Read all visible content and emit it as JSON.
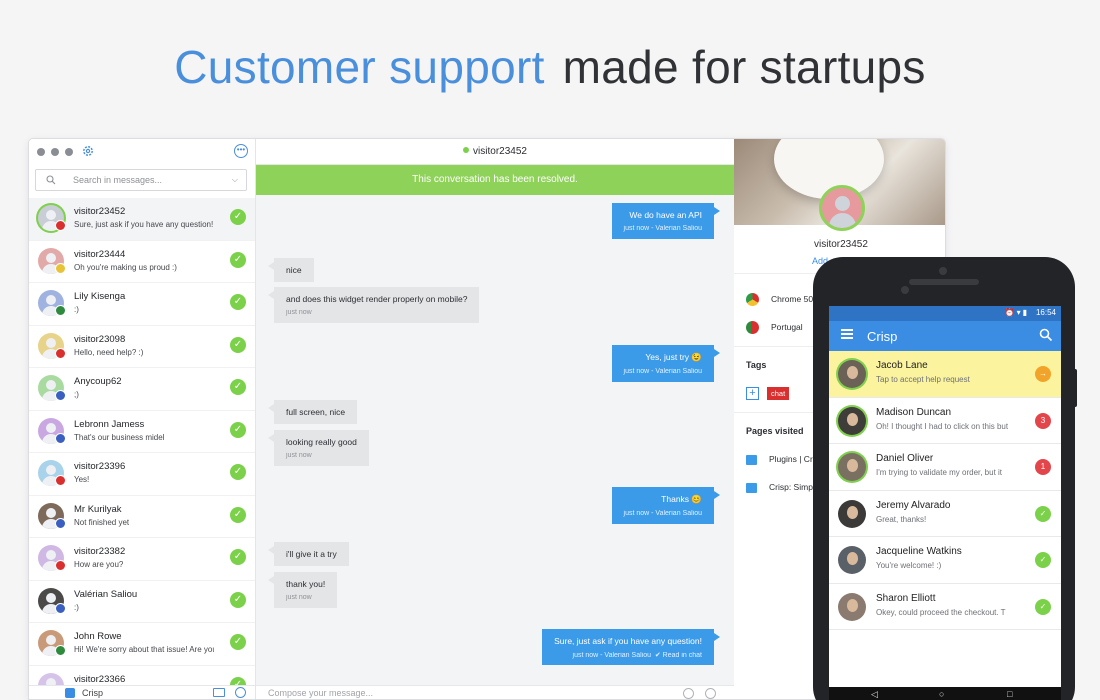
{
  "headline": {
    "accent": "Customer support",
    "rest": "made for startups"
  },
  "desktop": {
    "search_placeholder": "Search in messages...",
    "conversations": [
      {
        "name": "visitor23452",
        "message": "Sure, just ask if you have any question!",
        "flag": "#d9302f",
        "avatar": "#c8cdd6",
        "active": true
      },
      {
        "name": "visitor23444",
        "message": "Oh you're making us proud :)",
        "flag": "#e8c33a",
        "avatar": "#e2a9a9",
        "active": false
      },
      {
        "name": "Lily Kisenga",
        "message": ":)",
        "flag": "#2e8b3e",
        "avatar": "#9fb2e0",
        "active": false
      },
      {
        "name": "visitor23098",
        "message": "Hello, need help? :)",
        "flag": "#d9302f",
        "avatar": "#e7d38a",
        "active": false
      },
      {
        "name": "Anycoup62",
        "message": ";)",
        "flag": "#3a5fc0",
        "avatar": "#a9dba0",
        "active": false
      },
      {
        "name": "Lebronn Jamess",
        "message": "That's our business midel",
        "flag": "#3a5fc0",
        "avatar": "#c9a8e2",
        "active": false
      },
      {
        "name": "visitor23396",
        "message": "Yes!",
        "flag": "#d9302f",
        "avatar": "#a8d3ea",
        "active": false
      },
      {
        "name": "Mr Kurilyak",
        "message": "Not finished yet",
        "flag": "#3a5fc0",
        "avatar": "#7d6a5a",
        "active": false
      },
      {
        "name": "visitor23382",
        "message": "How are you?",
        "flag": "#d9302f",
        "avatar": "#d0b8e4",
        "active": false
      },
      {
        "name": "Valérian Saliou",
        "message": ":)",
        "flag": "#3a5fc0",
        "avatar": "#4c4a48",
        "active": false
      },
      {
        "name": "John Rowe",
        "message": "Hi! We're sorry about that issue! Are you",
        "flag": "#2e8b3e",
        "avatar": "#c99a7a",
        "active": false
      },
      {
        "name": "visitor23366",
        "message": "",
        "flag": "#d9302f",
        "avatar": "#d6c3ea",
        "active": false
      }
    ],
    "bottom_brand": "Crisp",
    "chat_header": "visitor23452",
    "resolved_banner": "This conversation has been resolved.",
    "messages": [
      {
        "dir": "out",
        "text": "We do have an API",
        "meta": "just now - Valerian Saliou",
        "read": ""
      },
      {
        "dir": "in",
        "text": "nice",
        "meta": "",
        "read": ""
      },
      {
        "dir": "in",
        "text": "and does this widget render properly on mobile?",
        "meta": "just now",
        "read": ""
      },
      {
        "dir": "out",
        "text": "Yes, just try 😉",
        "meta": "just now - Valerian Saliou",
        "read": ""
      },
      {
        "dir": "in",
        "text": "full screen, nice",
        "meta": "",
        "read": ""
      },
      {
        "dir": "in",
        "text": "looking really good",
        "meta": "just now",
        "read": ""
      },
      {
        "dir": "out",
        "text": "Thanks 😊",
        "meta": "just now - Valerian Saliou",
        "read": ""
      },
      {
        "dir": "in",
        "text": "i'll give it a try",
        "meta": "",
        "read": ""
      },
      {
        "dir": "in",
        "text": "thank you!",
        "meta": "just now",
        "read": ""
      },
      {
        "dir": "out",
        "text": "Sure, just ask if you have any question!",
        "meta": "just now - Valerian Saliou",
        "read": "✔ Read in chat"
      }
    ],
    "compose_placeholder": "Compose your message...",
    "profile": {
      "name": "visitor23452",
      "add_link": "Add",
      "browser": "Chrome 50",
      "country": "Portugal",
      "tags_title": "Tags",
      "tag": "chat",
      "pages_title": "Pages visited",
      "pages": [
        "Plugins | Cri",
        "Crisp: Simp"
      ]
    }
  },
  "phone": {
    "time": "16:54",
    "app_title": "Crisp",
    "rows": [
      {
        "name": "Jacob Lane",
        "message": "Tap to accept help request",
        "badge": "→",
        "badge_color": "#f2a32a",
        "highlight": true,
        "ring": true
      },
      {
        "name": "Madison Duncan",
        "message": "Oh! I thought I had to click on this but",
        "badge": "3",
        "badge_color": "#e2454a",
        "highlight": false,
        "ring": true
      },
      {
        "name": "Daniel Oliver",
        "message": "I'm trying to validate my order, but it",
        "badge": "1",
        "badge_color": "#e2454a",
        "highlight": false,
        "ring": true
      },
      {
        "name": "Jeremy Alvarado",
        "message": "Great, thanks!",
        "badge": "✓",
        "badge_color": "#7bd14a",
        "highlight": false,
        "ring": false
      },
      {
        "name": "Jacqueline Watkins",
        "message": "You're welcome! :)",
        "badge": "✓",
        "badge_color": "#7bd14a",
        "highlight": false,
        "ring": false
      },
      {
        "name": "Sharon Elliott",
        "message": "Okey, could proceed the checkout. T",
        "badge": "✓",
        "badge_color": "#7bd14a",
        "highlight": false,
        "ring": false
      }
    ]
  },
  "colors": {
    "accent": "#4a8fdc",
    "resolved": "#8fd25a",
    "outgoing": "#3b9be8",
    "online": "#7bd14a"
  }
}
